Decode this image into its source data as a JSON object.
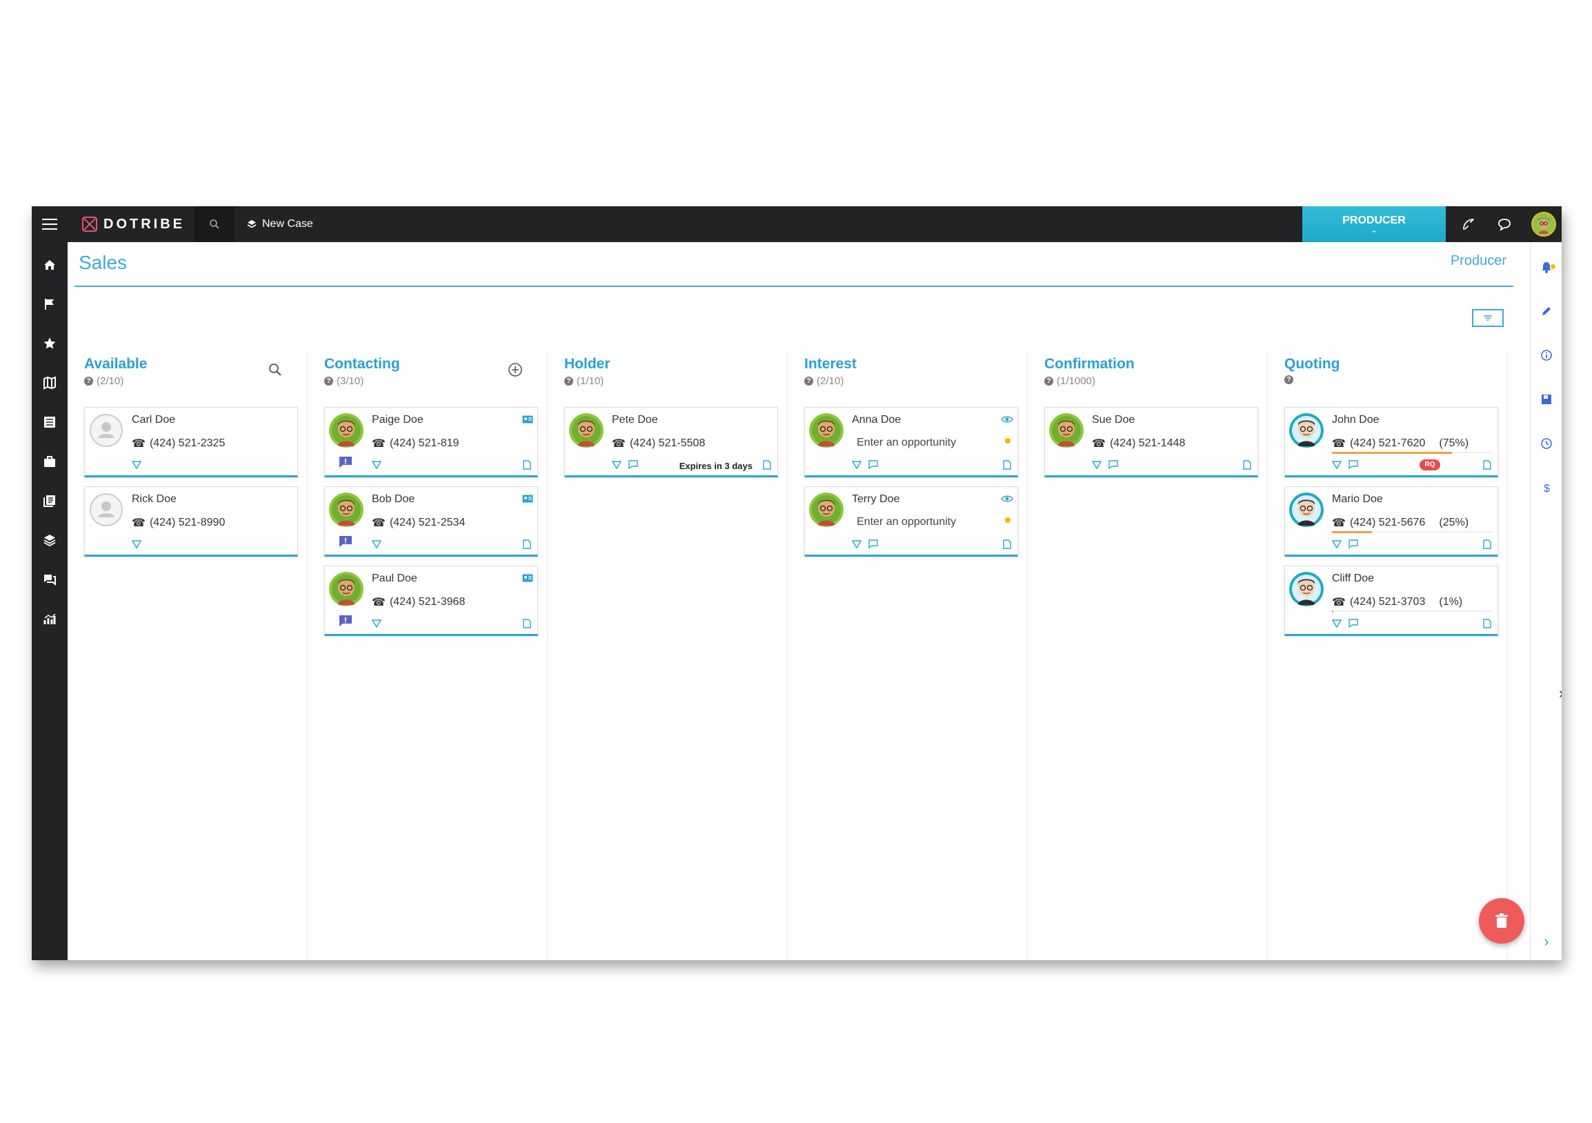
{
  "app": {
    "brand": "DOTRIBE",
    "new_case": "New Case",
    "role_button": "PRODUCER"
  },
  "page": {
    "title": "Sales",
    "subtitle": "Producer"
  },
  "colors": {
    "accent": "#2a9fd6",
    "topbar": "#222325",
    "producer": "#1ea9c6",
    "fab": "#ef5b5b"
  },
  "columns": [
    {
      "title": "Available",
      "count": "(2/10)",
      "action_icon": "search-icon",
      "cards": [
        {
          "name": "Carl Doe",
          "phone": "(424) 521-2325"
        },
        {
          "name": "Rick Doe",
          "phone": "(424) 521-8990"
        }
      ]
    },
    {
      "title": "Contacting",
      "count": "(3/10)",
      "action_icon": "add-circle-icon",
      "cards": [
        {
          "name": "Paige Doe",
          "phone": "(424) 521-819"
        },
        {
          "name": "Bob Doe",
          "phone": "(424) 521-2534"
        },
        {
          "name": "Paul Doe",
          "phone": "(424) 521-3968"
        }
      ]
    },
    {
      "title": "Holder",
      "count": "(1/10)",
      "cards": [
        {
          "name": "Pete Doe",
          "phone": "(424) 521-5508",
          "note": "Expires in 3 days"
        }
      ]
    },
    {
      "title": "Interest",
      "count": "(2/10)",
      "cards": [
        {
          "name": "Anna Doe",
          "opportunity": "Enter an opportunity"
        },
        {
          "name": "Terry Doe",
          "opportunity": "Enter an opportunity"
        }
      ]
    },
    {
      "title": "Confirmation",
      "count": "(1/1000)",
      "cards": [
        {
          "name": "Sue Doe",
          "phone": "(424) 521-1448"
        }
      ]
    },
    {
      "title": "Quoting",
      "count": "",
      "cards": [
        {
          "name": "John Doe",
          "phone": "(424) 521-7620",
          "percent": "(75%)",
          "progress": 0.75,
          "badge": "RQ"
        },
        {
          "name": "Mario Doe",
          "phone": "(424) 521-5676",
          "percent": "(25%)",
          "progress": 0.25
        },
        {
          "name": "Cliff Doe",
          "phone": "(424) 521-3703",
          "percent": "(1%)",
          "progress": 0.01
        }
      ]
    }
  ]
}
